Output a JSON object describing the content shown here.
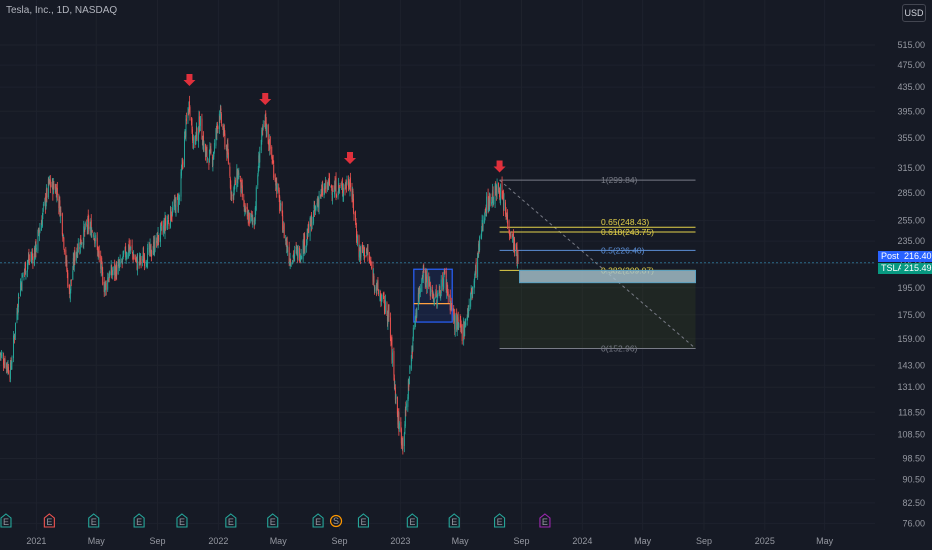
{
  "title": "Tesla, Inc., 1D, NASDAQ",
  "currency": "USD",
  "colors": {
    "bg": "#161a25",
    "grid": "#1e222d",
    "up": "#26a69a",
    "down": "#ef5350",
    "arrow": "#e0303c",
    "fib": "#787b86",
    "fib_gold": "#e4d24a",
    "fib_blue": "#5c8fd6",
    "box": "#2962ff",
    "zone": "#a8c3cf"
  },
  "price_labels": [
    {
      "label": "Post",
      "value": "216.40",
      "color": "#2962ff"
    },
    {
      "label": "TSLA",
      "value": "215.49",
      "color": "#089981"
    }
  ],
  "chart_data": {
    "type": "candlestick",
    "scale": "log",
    "ylim": [
      74,
      560
    ],
    "xlim": [
      "2020-10-20",
      "2025-08-10"
    ],
    "y_ticks": [
      515,
      475,
      435,
      395,
      355,
      315,
      285,
      255,
      235,
      215,
      195,
      175,
      159,
      143,
      131,
      118.5,
      108.5,
      98.5,
      90.5,
      82.5,
      76
    ],
    "y_tick_labels": [
      "515.00",
      "475.00",
      "435.00",
      "395.00",
      "355.00",
      "315.00",
      "285.00",
      "255.00",
      "235.00",
      "215.00",
      "195.00",
      "175.00",
      "159.00",
      "143.00",
      "131.00",
      "118.50",
      "108.50",
      "98.50",
      "90.50",
      "82.50",
      "76.00"
    ],
    "x_ticks": [
      {
        "label": "2021",
        "date": "2021-01-01"
      },
      {
        "label": "May",
        "date": "2021-05-01"
      },
      {
        "label": "Sep",
        "date": "2021-09-01"
      },
      {
        "label": "2022",
        "date": "2022-01-01"
      },
      {
        "label": "May",
        "date": "2022-05-01"
      },
      {
        "label": "Sep",
        "date": "2022-09-01"
      },
      {
        "label": "2023",
        "date": "2023-01-01"
      },
      {
        "label": "May",
        "date": "2023-05-01"
      },
      {
        "label": "Sep",
        "date": "2023-09-01"
      },
      {
        "label": "2024",
        "date": "2024-01-01"
      },
      {
        "label": "May",
        "date": "2024-05-01"
      },
      {
        "label": "Sep",
        "date": "2024-09-01"
      },
      {
        "label": "2025",
        "date": "2025-01-01"
      },
      {
        "label": "May",
        "date": "2025-05-01"
      }
    ],
    "price_path": [
      [
        "2020-10-20",
        150
      ],
      [
        "2020-11-10",
        140
      ],
      [
        "2020-11-28",
        195
      ],
      [
        "2020-12-12",
        215
      ],
      [
        "2020-12-29",
        225
      ],
      [
        "2021-01-26",
        295
      ],
      [
        "2021-02-10",
        290
      ],
      [
        "2021-02-20",
        260
      ],
      [
        "2021-03-08",
        190
      ],
      [
        "2021-03-20",
        225
      ],
      [
        "2021-04-14",
        250
      ],
      [
        "2021-04-26",
        245
      ],
      [
        "2021-05-18",
        195
      ],
      [
        "2021-05-26",
        205
      ],
      [
        "2021-06-18",
        212
      ],
      [
        "2021-07-05",
        230
      ],
      [
        "2021-07-22",
        215
      ],
      [
        "2021-08-19",
        225
      ],
      [
        "2021-09-15",
        250
      ],
      [
        "2021-10-01",
        265
      ],
      [
        "2021-10-15",
        280
      ],
      [
        "2021-10-26",
        360
      ],
      [
        "2021-11-04",
        410
      ],
      [
        "2021-11-12",
        345
      ],
      [
        "2021-11-25",
        380
      ],
      [
        "2021-12-06",
        330
      ],
      [
        "2021-12-21",
        330
      ],
      [
        "2022-01-03",
        395
      ],
      [
        "2022-01-20",
        330
      ],
      [
        "2022-01-28",
        280
      ],
      [
        "2022-02-10",
        310
      ],
      [
        "2022-02-24",
        260
      ],
      [
        "2022-03-14",
        255
      ],
      [
        "2022-03-25",
        340
      ],
      [
        "2022-04-05",
        380
      ],
      [
        "2022-04-26",
        300
      ],
      [
        "2022-05-12",
        245
      ],
      [
        "2022-05-24",
        220
      ],
      [
        "2022-06-14",
        225
      ],
      [
        "2022-06-28",
        240
      ],
      [
        "2022-07-22",
        280
      ],
      [
        "2022-08-10",
        295
      ],
      [
        "2022-08-22",
        290
      ],
      [
        "2022-09-07",
        290
      ],
      [
        "2022-09-22",
        300
      ],
      [
        "2022-10-10",
        225
      ],
      [
        "2022-10-26",
        225
      ],
      [
        "2022-11-14",
        195
      ],
      [
        "2022-12-08",
        175
      ],
      [
        "2022-12-27",
        115
      ],
      [
        "2023-01-06",
        105
      ],
      [
        "2023-01-20",
        140
      ],
      [
        "2023-01-31",
        175
      ],
      [
        "2023-02-15",
        210
      ],
      [
        "2023-03-01",
        195
      ],
      [
        "2023-03-15",
        185
      ],
      [
        "2023-03-30",
        205
      ],
      [
        "2023-04-20",
        170
      ],
      [
        "2023-05-05",
        163
      ],
      [
        "2023-05-18",
        180
      ],
      [
        "2023-05-31",
        205
      ],
      [
        "2023-06-20",
        270
      ],
      [
        "2023-07-03",
        280
      ],
      [
        "2023-07-19",
        290
      ],
      [
        "2023-08-01",
        260
      ],
      [
        "2023-08-10",
        245
      ],
      [
        "2023-08-21",
        225
      ],
      [
        "2023-08-25",
        215
      ]
    ],
    "peak_arrows": [
      "2021-11-04",
      "2022-04-05",
      "2022-09-22",
      "2023-07-19"
    ],
    "fibonacci": {
      "x_start": "2023-07-19",
      "x_end": "2024-08-15",
      "levels": [
        {
          "ratio": "1",
          "price": 299.84,
          "label": "1(299.84)",
          "color": "#787b86"
        },
        {
          "ratio": "0.65",
          "price": 248.43,
          "label": "0.65(248.43)",
          "color": "#e4d24a"
        },
        {
          "ratio": "0.618",
          "price": 243.75,
          "label": "0.618(243.75)",
          "color": "#e4d24a"
        },
        {
          "ratio": "0.5",
          "price": 226.4,
          "label": "0.5(226.40)",
          "color": "#5c8fd6"
        },
        {
          "ratio": "0.382",
          "price": 209.07,
          "label": "0.382(209.07)",
          "color": "#e4d24a"
        },
        {
          "ratio": "0",
          "price": 152.96,
          "label": "0(152.96)",
          "color": "#787b86"
        }
      ]
    },
    "consolidation_box": {
      "x_start": "2023-01-28",
      "x_end": "2023-04-15",
      "top": 210,
      "bottom": 170,
      "mid": 183
    },
    "target_zone": {
      "x_start": "2023-08-28",
      "x_end": "2024-08-15",
      "top": 209,
      "bottom": 199
    },
    "current_price": 215.49,
    "event_markers": [
      {
        "date": "2020-11-01",
        "kind": "E",
        "color": "#26a69a"
      },
      {
        "date": "2021-01-27",
        "kind": "E",
        "color": "#ef5350"
      },
      {
        "date": "2021-04-26",
        "kind": "E",
        "color": "#26a69a"
      },
      {
        "date": "2021-07-26",
        "kind": "E",
        "color": "#26a69a"
      },
      {
        "date": "2021-10-20",
        "kind": "E",
        "color": "#26a69a"
      },
      {
        "date": "2022-01-26",
        "kind": "E",
        "color": "#26a69a"
      },
      {
        "date": "2022-04-20",
        "kind": "E",
        "color": "#26a69a"
      },
      {
        "date": "2022-07-20",
        "kind": "E",
        "color": "#26a69a"
      },
      {
        "date": "2022-08-25",
        "kind": "S",
        "color": "#ff9800"
      },
      {
        "date": "2022-10-19",
        "kind": "E",
        "color": "#26a69a"
      },
      {
        "date": "2023-01-25",
        "kind": "E",
        "color": "#26a69a"
      },
      {
        "date": "2023-04-19",
        "kind": "E",
        "color": "#26a69a"
      },
      {
        "date": "2023-07-19",
        "kind": "E",
        "color": "#26a69a"
      },
      {
        "date": "2023-10-18",
        "kind": "E",
        "color": "#9c27b0"
      }
    ]
  }
}
